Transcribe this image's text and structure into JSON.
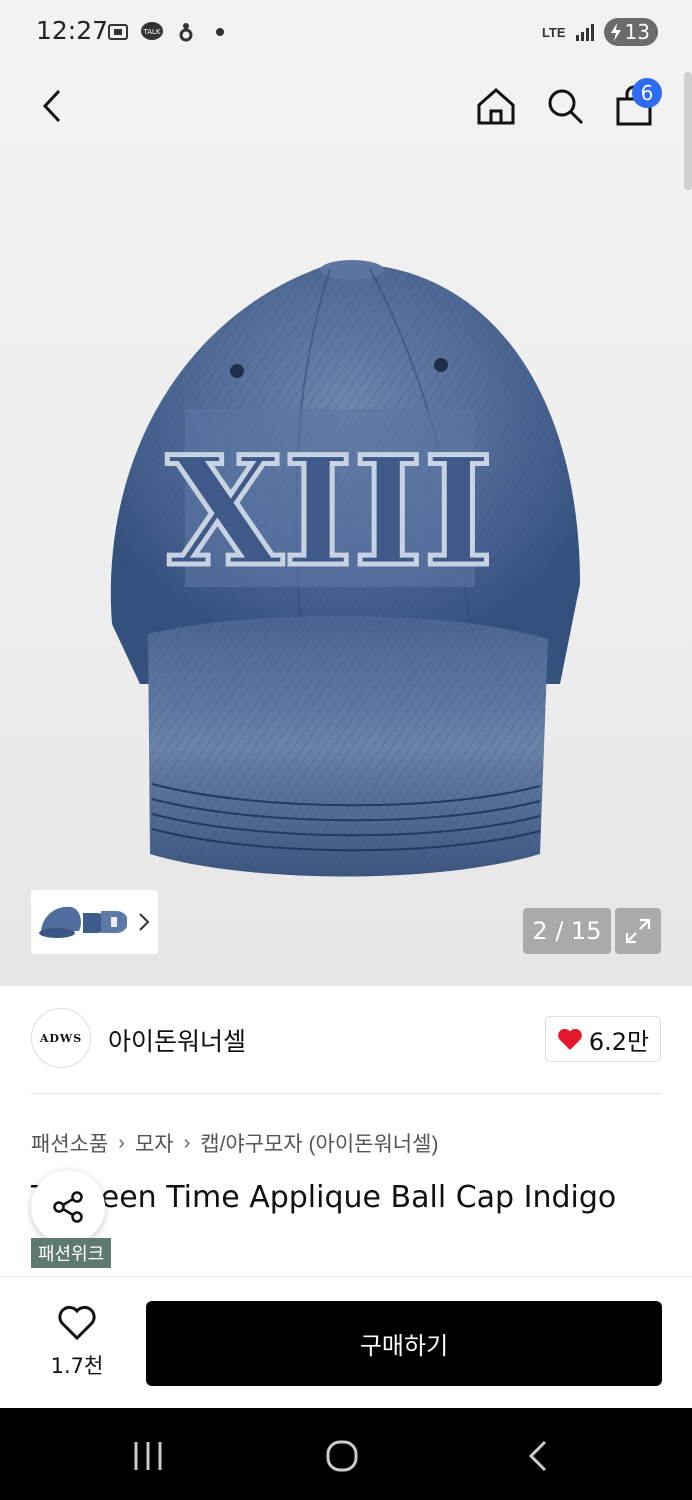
{
  "status": {
    "time": "12:27",
    "network": "LTE",
    "battery": "13"
  },
  "nav": {
    "cart_count": "6"
  },
  "gallery": {
    "counter": "2 / 15",
    "cap_text": "XIII"
  },
  "brand": {
    "logo_text": "ADWS",
    "name": "아이돈워너셀",
    "likes": "6.2만"
  },
  "breadcrumb": [
    "패션소품",
    "모자",
    "캡/야구모자 (아이돈워너셀)"
  ],
  "product": {
    "title": "Thirteen Time Applique Ball Cap Indigo",
    "tag": "패션위크"
  },
  "action": {
    "wish_count": "1.7천",
    "buy_label": "구매하기"
  },
  "colors": {
    "accent_blue": "#2f6bf2",
    "heart_red": "#e3182d",
    "tag_green": "#5e7a6e",
    "denim": "#4a6791"
  }
}
